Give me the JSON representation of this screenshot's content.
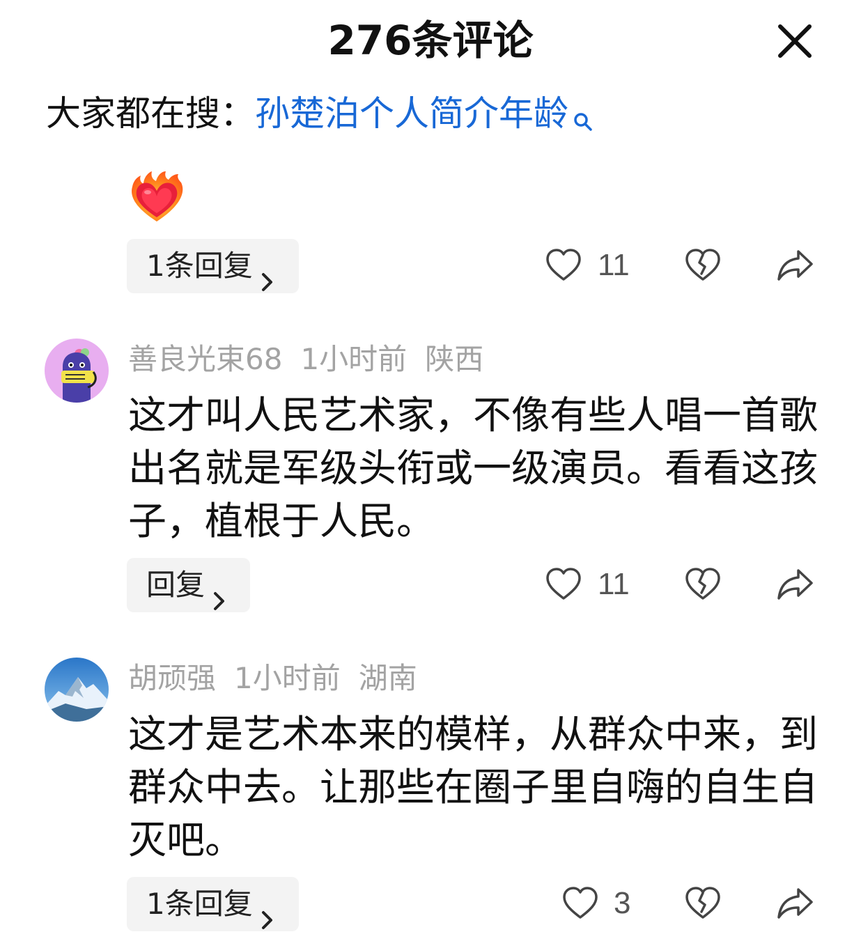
{
  "header": {
    "title": "276条评论",
    "close_icon": "close-icon"
  },
  "hot_search": {
    "prefix": "大家都在搜：",
    "term": "孙楚泊个人简介年龄",
    "icon": "search-icon"
  },
  "first_comment": {
    "emoji": "heart-on-fire-emoji",
    "reply_label": "1条回复",
    "like_count": "11"
  },
  "comments": [
    {
      "username": "善良光束68",
      "time": "1小时前",
      "location": "陕西",
      "text": "这才叫人民艺术家，不像有些人唱一首歌出名就是军级头衔或一级演员。看看这孩子，植根于人民。",
      "reply_label": "回复",
      "like_count": "11"
    },
    {
      "username": "胡顽强",
      "time": "1小时前",
      "location": "湖南",
      "text": "这才是艺术本来的模样，从群众中来，到群众中去。让那些在圈子里自嗨的自生自灭吧。",
      "reply_label": "1条回复",
      "like_count": "3"
    }
  ],
  "colors": {
    "link": "#1868d6",
    "meta": "#a3a3a3",
    "chip_bg": "#f3f3f3",
    "icon": "#444444"
  }
}
